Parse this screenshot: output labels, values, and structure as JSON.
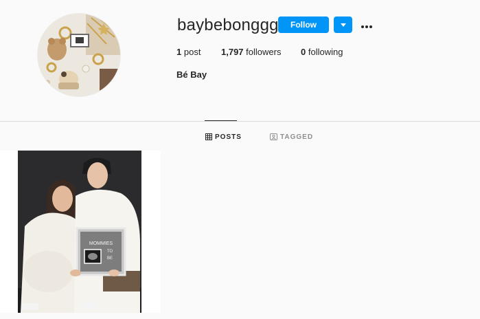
{
  "profile": {
    "username": "baybebonggg",
    "full_name": "Bé Bay",
    "follow_label": "Follow",
    "avatar_icon": "profile-avatar-flatlay"
  },
  "stats": {
    "posts_count": "1",
    "posts_label": "post",
    "followers_count": "1,797",
    "followers_label": "followers",
    "following_count": "0",
    "following_label": "following"
  },
  "tabs": [
    {
      "label": "POSTS",
      "icon": "grid-icon",
      "active": true
    },
    {
      "label": "TAGGED",
      "icon": "tag-user-icon",
      "active": false
    }
  ],
  "posts": [
    {
      "board_text": "MOMMIES TO BE",
      "description_icon": "couple-photo-with-ultrasound-board"
    }
  ],
  "colors": {
    "accent": "#0095f6",
    "background": "#fafafa",
    "text": "#262626",
    "muted": "#8e8e8e",
    "divider": "#dbdbdb"
  }
}
